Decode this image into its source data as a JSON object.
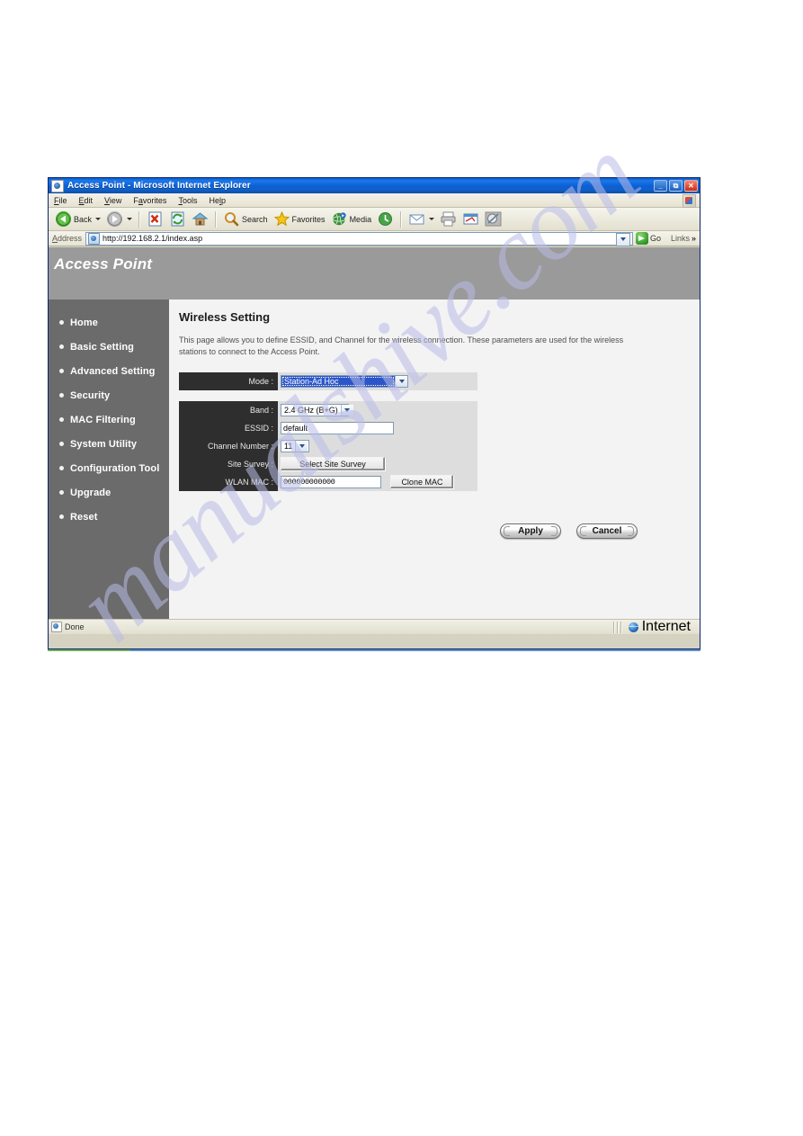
{
  "browser": {
    "title": "Access Point - Microsoft Internet Explorer",
    "window_controls": {
      "minimize": "_",
      "maximize": "□",
      "close": "×"
    },
    "menu": [
      {
        "label": "File",
        "accel": "F"
      },
      {
        "label": "Edit",
        "accel": "E"
      },
      {
        "label": "View",
        "accel": "V"
      },
      {
        "label": "Favorites",
        "accel": "a"
      },
      {
        "label": "Tools",
        "accel": "T"
      },
      {
        "label": "Help",
        "accel": "H"
      }
    ],
    "toolbar": {
      "back_label": "Back",
      "forward_label": "",
      "stop_label": "",
      "refresh_label": "",
      "home_label": "",
      "search_label": "Search",
      "favorites_label": "Favorites",
      "media_label": "Media",
      "history_label": "",
      "mail_label": "",
      "print_label": "",
      "edit_label": "",
      "discuss_label": ""
    },
    "address": {
      "label": "Address",
      "accel": "A",
      "url": "http://192.168.2.1/index.asp",
      "go_label": "Go",
      "links_label": "Links",
      "links_chevron": "»"
    },
    "status": {
      "text": "Done",
      "zone": "Internet"
    }
  },
  "banner": {
    "brand": "Access Point"
  },
  "sidebar": {
    "items": [
      {
        "label": "Home"
      },
      {
        "label": "Basic Setting"
      },
      {
        "label": "Advanced Setting"
      },
      {
        "label": "Security"
      },
      {
        "label": "MAC Filtering"
      },
      {
        "label": "System Utility"
      },
      {
        "label": "Configuration Tool"
      },
      {
        "label": "Upgrade"
      },
      {
        "label": "Reset"
      }
    ]
  },
  "main": {
    "title": "Wireless Setting",
    "description": "This page allows you to define ESSID, and Channel for the wireless connection. These parameters are used for the wireless stations to connect to the Access Point.",
    "fields": {
      "mode": {
        "label": "Mode :",
        "value": "Station-Ad Hoc"
      },
      "band": {
        "label": "Band :",
        "value": "2.4 GHz (B+G)"
      },
      "essid": {
        "label": "ESSID :",
        "value": "default"
      },
      "channel": {
        "label": "Channel Number :",
        "value": "11"
      },
      "site_survey": {
        "label": "Site Survey :",
        "button": "Select Site Survey"
      },
      "wlan_mac": {
        "label": "WLAN MAC :",
        "value": "000000000000",
        "button": "Clone MAC"
      }
    },
    "actions": {
      "apply": "Apply",
      "cancel": "Cancel"
    }
  },
  "watermark": {
    "text": "manualshive.com"
  },
  "colors": {
    "titlebar_blue": "#0d5fd6",
    "banner_gray": "#9a9a9a",
    "sidebar_gray": "#6b6b6b",
    "label_dark": "#2e2e2e",
    "field_gray": "#dddddd",
    "content_bg": "#f3f3f3",
    "select_highlight": "#2c56c8",
    "watermark": "#b9bce8"
  }
}
